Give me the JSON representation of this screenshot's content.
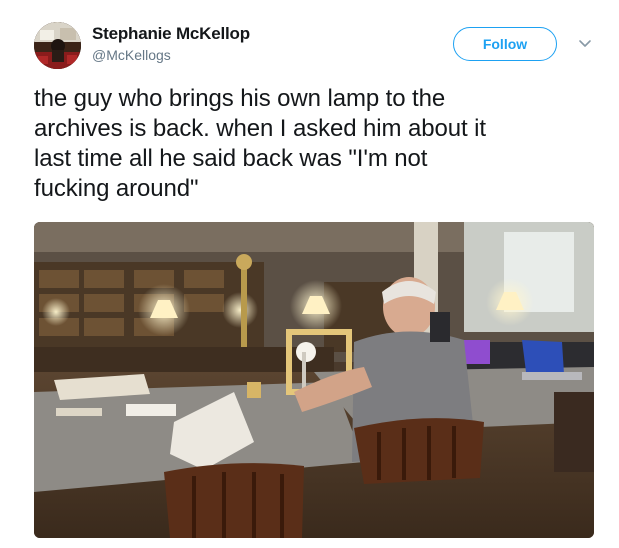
{
  "author": {
    "name": "Stephanie McKellop",
    "handle": "@McKellogs",
    "avatar_icon": "profile-photo"
  },
  "actions": {
    "follow_label": "Follow",
    "menu_icon": "chevron-down-icon"
  },
  "tweet": {
    "text": "the guy who brings his own lamp to the\narchives is back. when I asked him about it\nlast time all he said back was \"I'm not\nfucking around\""
  },
  "media": {
    "kind": "photo"
  },
  "colors": {
    "accent": "#1da1f2",
    "text": "#14171a",
    "secondary_text": "#657786"
  }
}
